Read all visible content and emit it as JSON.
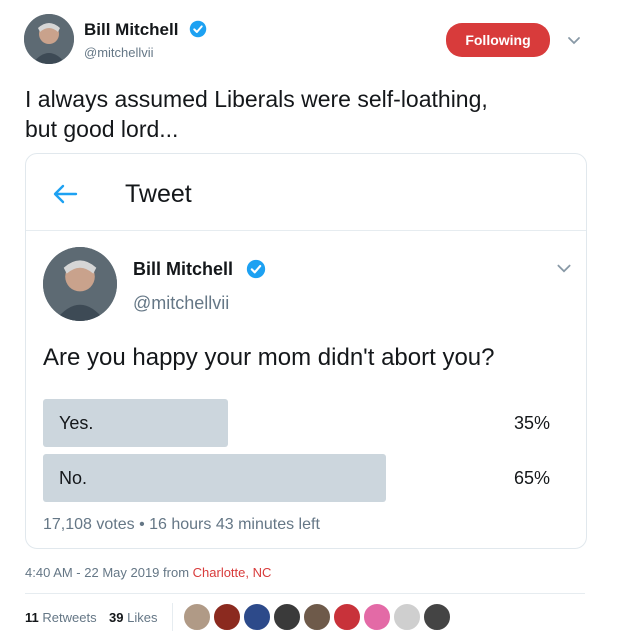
{
  "header": {
    "name": "Bill Mitchell",
    "handle": "@mitchellvii",
    "follow_label": "Following"
  },
  "tweet": {
    "text_line1": "I always assumed Liberals were self-loathing,",
    "text_line2": "but good lord..."
  },
  "embedded": {
    "nav_title": "Tweet",
    "name": "Bill Mitchell",
    "handle": "@mitchellvii",
    "poll": {
      "question": "Are you happy your mom didn't abort you?",
      "options": [
        {
          "label": "Yes.",
          "percent_text": "35%",
          "percent": 35
        },
        {
          "label": "No.",
          "percent_text": "65%",
          "percent": 65
        }
      ],
      "meta": "17,108 votes • 16 hours 43 minutes left"
    }
  },
  "meta": {
    "timestamp": "4:40 AM - 22 May 2019 from ",
    "location": "Charlotte, NC"
  },
  "stats": {
    "retweets_count": "11",
    "retweets_label": "Retweets",
    "likes_count": "39",
    "likes_label": "Likes"
  },
  "colors": {
    "accent": "#d83b3b",
    "verified": "#1da1f2",
    "poll_bar": "#ccd6dd"
  },
  "icons": [
    "verified-badge-icon",
    "chevron-down-icon",
    "back-arrow-icon"
  ]
}
